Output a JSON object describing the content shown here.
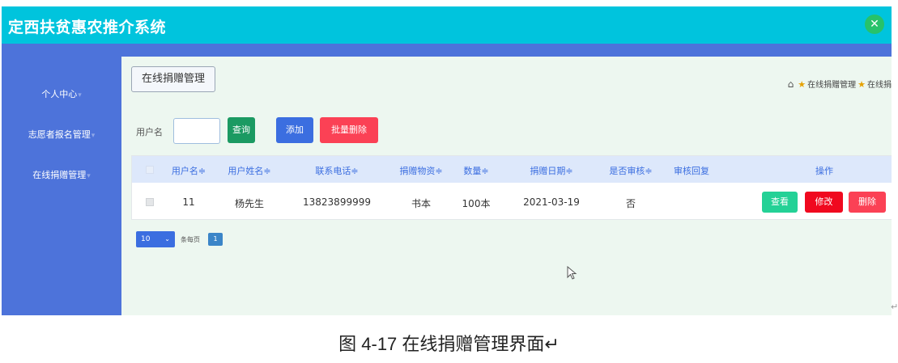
{
  "header": {
    "title": "定西扶贫惠农推介系统",
    "close_glyph": "✕"
  },
  "sidebar": {
    "items": [
      {
        "label": "个人中心",
        "caret": "▾"
      },
      {
        "label": "志愿者报名管理",
        "caret": "▾"
      },
      {
        "label": "在线捐赠管理",
        "caret": "▾"
      }
    ]
  },
  "page": {
    "title_button": "在线捐赠管理",
    "breadcrumb": {
      "home_icon": "⌂",
      "star": "★",
      "item1": "在线捐赠管理",
      "item2": "在线捐"
    }
  },
  "search": {
    "label": "用户名",
    "value": "",
    "query_label": "查询",
    "add_label": "添加",
    "batch_delete_label": "批量删除"
  },
  "table": {
    "headers": [
      "用户名≑",
      "用户姓名≑",
      "联系电话≑",
      "捐赠物资≑",
      "数量≑",
      "捐赠日期≑",
      "是否审核≑",
      "审核回复",
      "操作"
    ],
    "rows": [
      {
        "username": "11",
        "name": "杨先生",
        "phone": "13823899999",
        "item": "书本",
        "quantity": "100本",
        "date": "2021-03-19",
        "reviewed": "否",
        "reply": ""
      }
    ],
    "row_actions": {
      "view": "查看",
      "edit": "修改",
      "delete": "删除"
    }
  },
  "pagination": {
    "page_size": "10",
    "per_page_label": "条每页",
    "current_page": "1",
    "chevron": "⌄"
  },
  "caption": "图 4-17 在线捐赠管理界面↵",
  "edge_glyph": "↵",
  "colors": {
    "header_bg": "#00c4dd",
    "sidebar_bg": "#4d73da",
    "main_bg": "#edf7f0",
    "query_btn": "#1b9a62",
    "add_btn": "#3b6ee0",
    "batch_delete_btn": "#fb4155",
    "view_btn": "#24d196",
    "edit_btn": "#f0091f",
    "delete_btn": "#fb4155",
    "table_header_bg": "#dde8fb"
  }
}
